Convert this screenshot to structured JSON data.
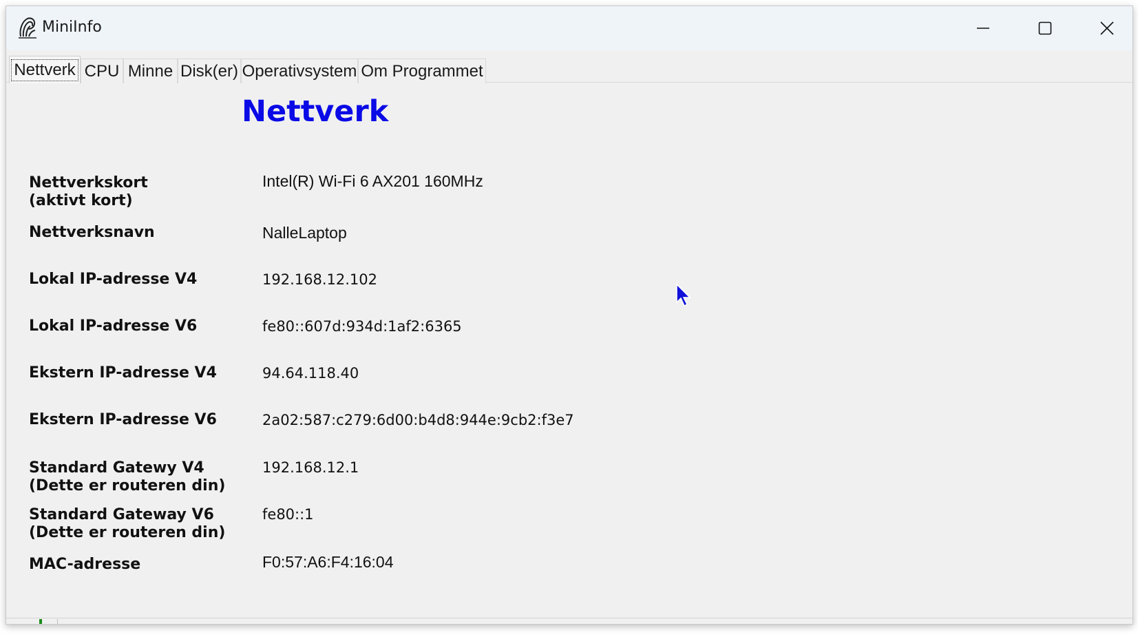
{
  "window": {
    "title": "MiniInfo",
    "icon": "app-logo-icon",
    "controls": [
      "minimize-icon",
      "maximize-icon",
      "close-icon"
    ]
  },
  "tabs": [
    {
      "label": "Nettverk",
      "active": true
    },
    {
      "label": "CPU",
      "active": false
    },
    {
      "label": "Minne",
      "active": false
    },
    {
      "label": "Disk(er)",
      "active": false
    },
    {
      "label": "Operativsystem",
      "active": false
    },
    {
      "label": "Om Programmet",
      "active": false
    }
  ],
  "page": {
    "heading": "Nettverk",
    "heading_color": "#0a0ae6"
  },
  "rows": [
    {
      "label": "Nettverkskort\n(aktivt kort)",
      "value": "Intel(R) Wi-Fi 6 AX201 160MHz"
    },
    {
      "label": "Nettverksnavn",
      "value": "NalleLaptop"
    },
    {
      "label": "Lokal IP-adresse V4",
      "value": "192.168.12.102"
    },
    {
      "label": "Lokal IP-adresse V6",
      "value": "fe80::607d:934d:1af2:6365"
    },
    {
      "label": "Ekstern IP-adresse V4",
      "value": "94.64.118.40"
    },
    {
      "label": "Ekstern IP-adresse V6",
      "value": "2a02:587:c279:6d00:b4d8:944e:9cb2:f3e7"
    },
    {
      "label": "Standard Gatewy V4\n(Dette er routeren din)",
      "value": "192.168.12.1"
    },
    {
      "label": "Standard Gateway V6\n(Dette er routeren din)",
      "value": "fe80::1"
    },
    {
      "label": "MAC-adresse",
      "value": "F0:57:A6:F4:16:04"
    }
  ]
}
